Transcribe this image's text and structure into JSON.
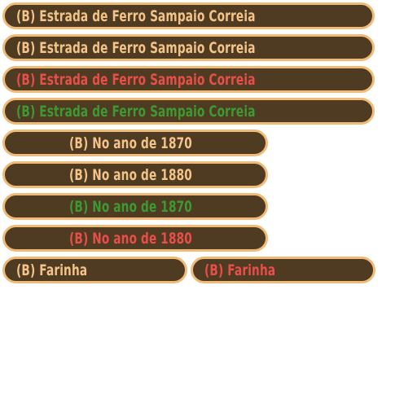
{
  "buttons": {
    "title_normal": "(B) Estrada de Ferro Sampaio Correia",
    "title_hover": "(B) Estrada de Ferro Sampaio Correia",
    "title_wrong": "(B) Estrada de Ferro Sampaio Correia",
    "title_right": "(B) Estrada de Ferro Sampaio Correia",
    "year_1870_normal": "(B) No ano de 1870",
    "year_1880_normal": "(B) No ano de 1880",
    "year_1870_right": "(B) No ano de 1870",
    "year_1880_wrong": "(B) No ano de 1880",
    "farinha_normal": "(B) Farinha",
    "farinha_wrong": "(B) Farinha"
  },
  "colors": {
    "button_fill": "#4f3a22",
    "button_border": "#f0bb78",
    "text_normal": "#f3c48a",
    "text_wrong": "#e84f4a",
    "text_right": "#3d9a33"
  }
}
